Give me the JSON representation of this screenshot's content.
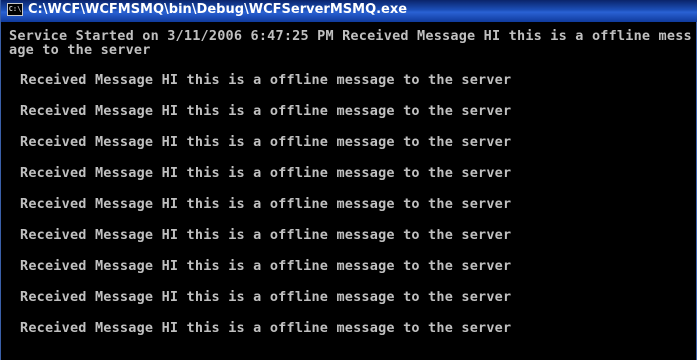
{
  "window": {
    "title": "C:\\WCF\\WCFMSMQ\\bin\\Debug\\WCFServerMSMQ.exe",
    "icon_label": "C:\\",
    "icon": "console-icon"
  },
  "console": {
    "header_text": "Service Started on 3/11/2006 6:47:25 PM Received Message HI this is a offline message to the server",
    "lines": [
      "Received Message HI this is a offline message to the server",
      "Received Message HI this is a offline message to the server",
      "Received Message HI this is a offline message to the server",
      "Received Message HI this is a offline message to the server",
      "Received Message HI this is a offline message to the server",
      "Received Message HI this is a offline message to the server",
      "Received Message HI this is a offline message to the server",
      "Received Message HI this is a offline message to the server",
      "Received Message HI this is a offline message to the server"
    ]
  },
  "colors": {
    "background": "#000000",
    "text": "#c0c0c0",
    "titlebar": "#1c4fb8"
  }
}
